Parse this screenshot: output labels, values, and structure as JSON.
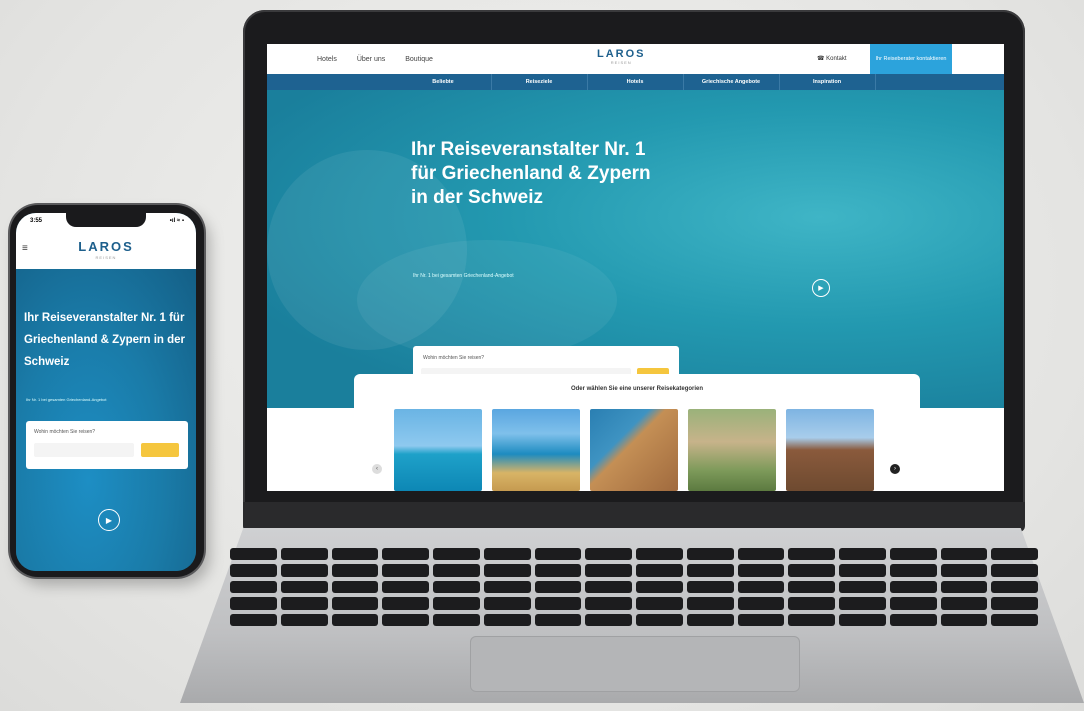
{
  "laptop_site": {
    "nav": {
      "links": [
        "Hotels",
        "Über uns",
        "Boutique"
      ],
      "brand": "LAROS",
      "brand_sub": "REISEN",
      "kontakt": "Kontakt",
      "cta": "Ihr Reiseberater kontaktieren"
    },
    "subnav": [
      "Beliebte",
      "Reiseziele",
      "Hotels",
      "Griechische Angebote",
      "Inspiration"
    ],
    "hero": {
      "title": "Ihr Reiseveranstalter Nr. 1 für Griechenland & Zypern in der Schweiz",
      "subtitle": "Ihr Nr. 1 bei gesamten Griechenland-Angebot",
      "search_label": "Wohin möchten Sie reisen?",
      "play_icon": "play-icon"
    },
    "categories": {
      "title": "Oder wählen Sie eine unserer Reisekategorien"
    }
  },
  "phone_site": {
    "status": {
      "time": "3:55",
      "signal": "•ıl ≈ ▪"
    },
    "brand": "LAROS",
    "brand_sub": "REISEN",
    "hero": {
      "title": "Ihr Reiseveranstalter Nr. 1 für Griechenland & Zypern in der Schweiz",
      "subtitle": "Ihr Nr. 1 bei gesamten Griechenland-Angebot",
      "search_label": "Wohin möchten Sie reisen?"
    }
  }
}
